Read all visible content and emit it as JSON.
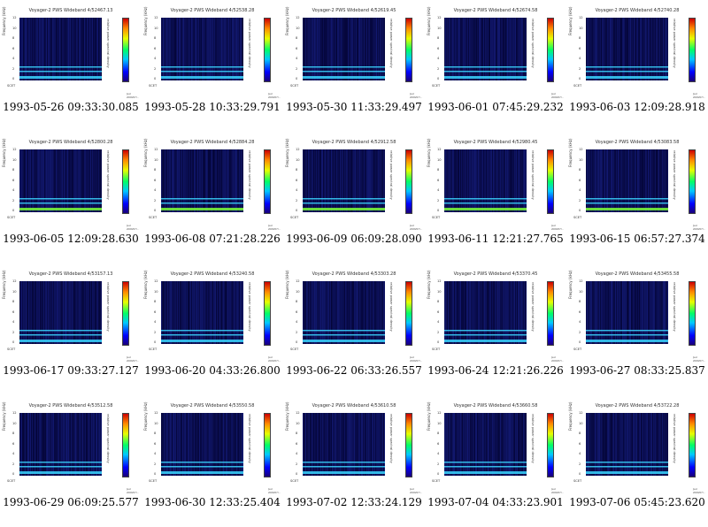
{
  "panels": [
    {
      "title": "Voyager-2 PWS Wideband  4/52467.13",
      "caption": "1993-05-26 09:33:30.085"
    },
    {
      "title": "Voyager-2 PWS Wideband  4/52538.28",
      "caption": "1993-05-28 10:33:29.791"
    },
    {
      "title": "Voyager-2 PWS Wideband  4/52619.45",
      "caption": "1993-05-30 11:33:29.497"
    },
    {
      "title": "Voyager-2 PWS Wideband  4/52674.58",
      "caption": "1993-06-01 07:45:29.232"
    },
    {
      "title": "Voyager-2 PWS Wideband  4/52740.28",
      "caption": "1993-06-03 12:09:28.918"
    },
    {
      "title": "Voyager-2 PWS Wideband  4/52800.28",
      "caption": "1993-06-05 12:09:28.630"
    },
    {
      "title": "Voyager-2 PWS Wideband  4/52884.28",
      "caption": "1993-06-08 07:21:28.226"
    },
    {
      "title": "Voyager-2 PWS Wideband  4/52912.58",
      "caption": "1993-06-09 06:09:28.090"
    },
    {
      "title": "Voyager-2 PWS Wideband  4/52980.45",
      "caption": "1993-06-11 12:21:27.765"
    },
    {
      "title": "Voyager-2 PWS Wideband  4/53083.58",
      "caption": "1993-06-15 06:57:27.374"
    },
    {
      "title": "Voyager-2 PWS Wideband  4/53157.13",
      "caption": "1993-06-17 09:33:27.127"
    },
    {
      "title": "Voyager-2 PWS Wideband  4/53240.58",
      "caption": "1993-06-20 04:33:26.800"
    },
    {
      "title": "Voyager-2 PWS Wideband  4/53303.28",
      "caption": "1993-06-22 06:33:26.557"
    },
    {
      "title": "Voyager-2 PWS Wideband  4/53370.45",
      "caption": "1993-06-24 12:21:26.226"
    },
    {
      "title": "Voyager-2 PWS Wideband  4/53455.58",
      "caption": "1993-06-27 08:33:25.837"
    },
    {
      "title": "Voyager-2 PWS Wideband  4/53512.58",
      "caption": "1993-06-29 06:09:25.577"
    },
    {
      "title": "Voyager-2 PWS Wideband  4/53550.58",
      "caption": "1993-06-30 12:33:25.404"
    },
    {
      "title": "Voyager-2 PWS Wideband  4/53610.58",
      "caption": "1993-07-02 12:33:24.129"
    },
    {
      "title": "Voyager-2 PWS Wideband  4/53660.58",
      "caption": "1993-07-04 04:33:23.901"
    },
    {
      "title": "Voyager-2 PWS Wideband  4/53722.28",
      "caption": "1993-07-06 05:45:23.620"
    }
  ],
  "axis": {
    "ylabel": "Frequency (kHz)",
    "yticks": [
      "12",
      "10",
      "8",
      "6",
      "4",
      "2",
      "0"
    ],
    "clabel": "relative power spectral density",
    "scet": "SCET",
    "stamp": "jwd 2009/07/..."
  },
  "colors": {
    "background": "#05063a",
    "band": "#3bd6ff",
    "noise": "#2a3bd0"
  }
}
